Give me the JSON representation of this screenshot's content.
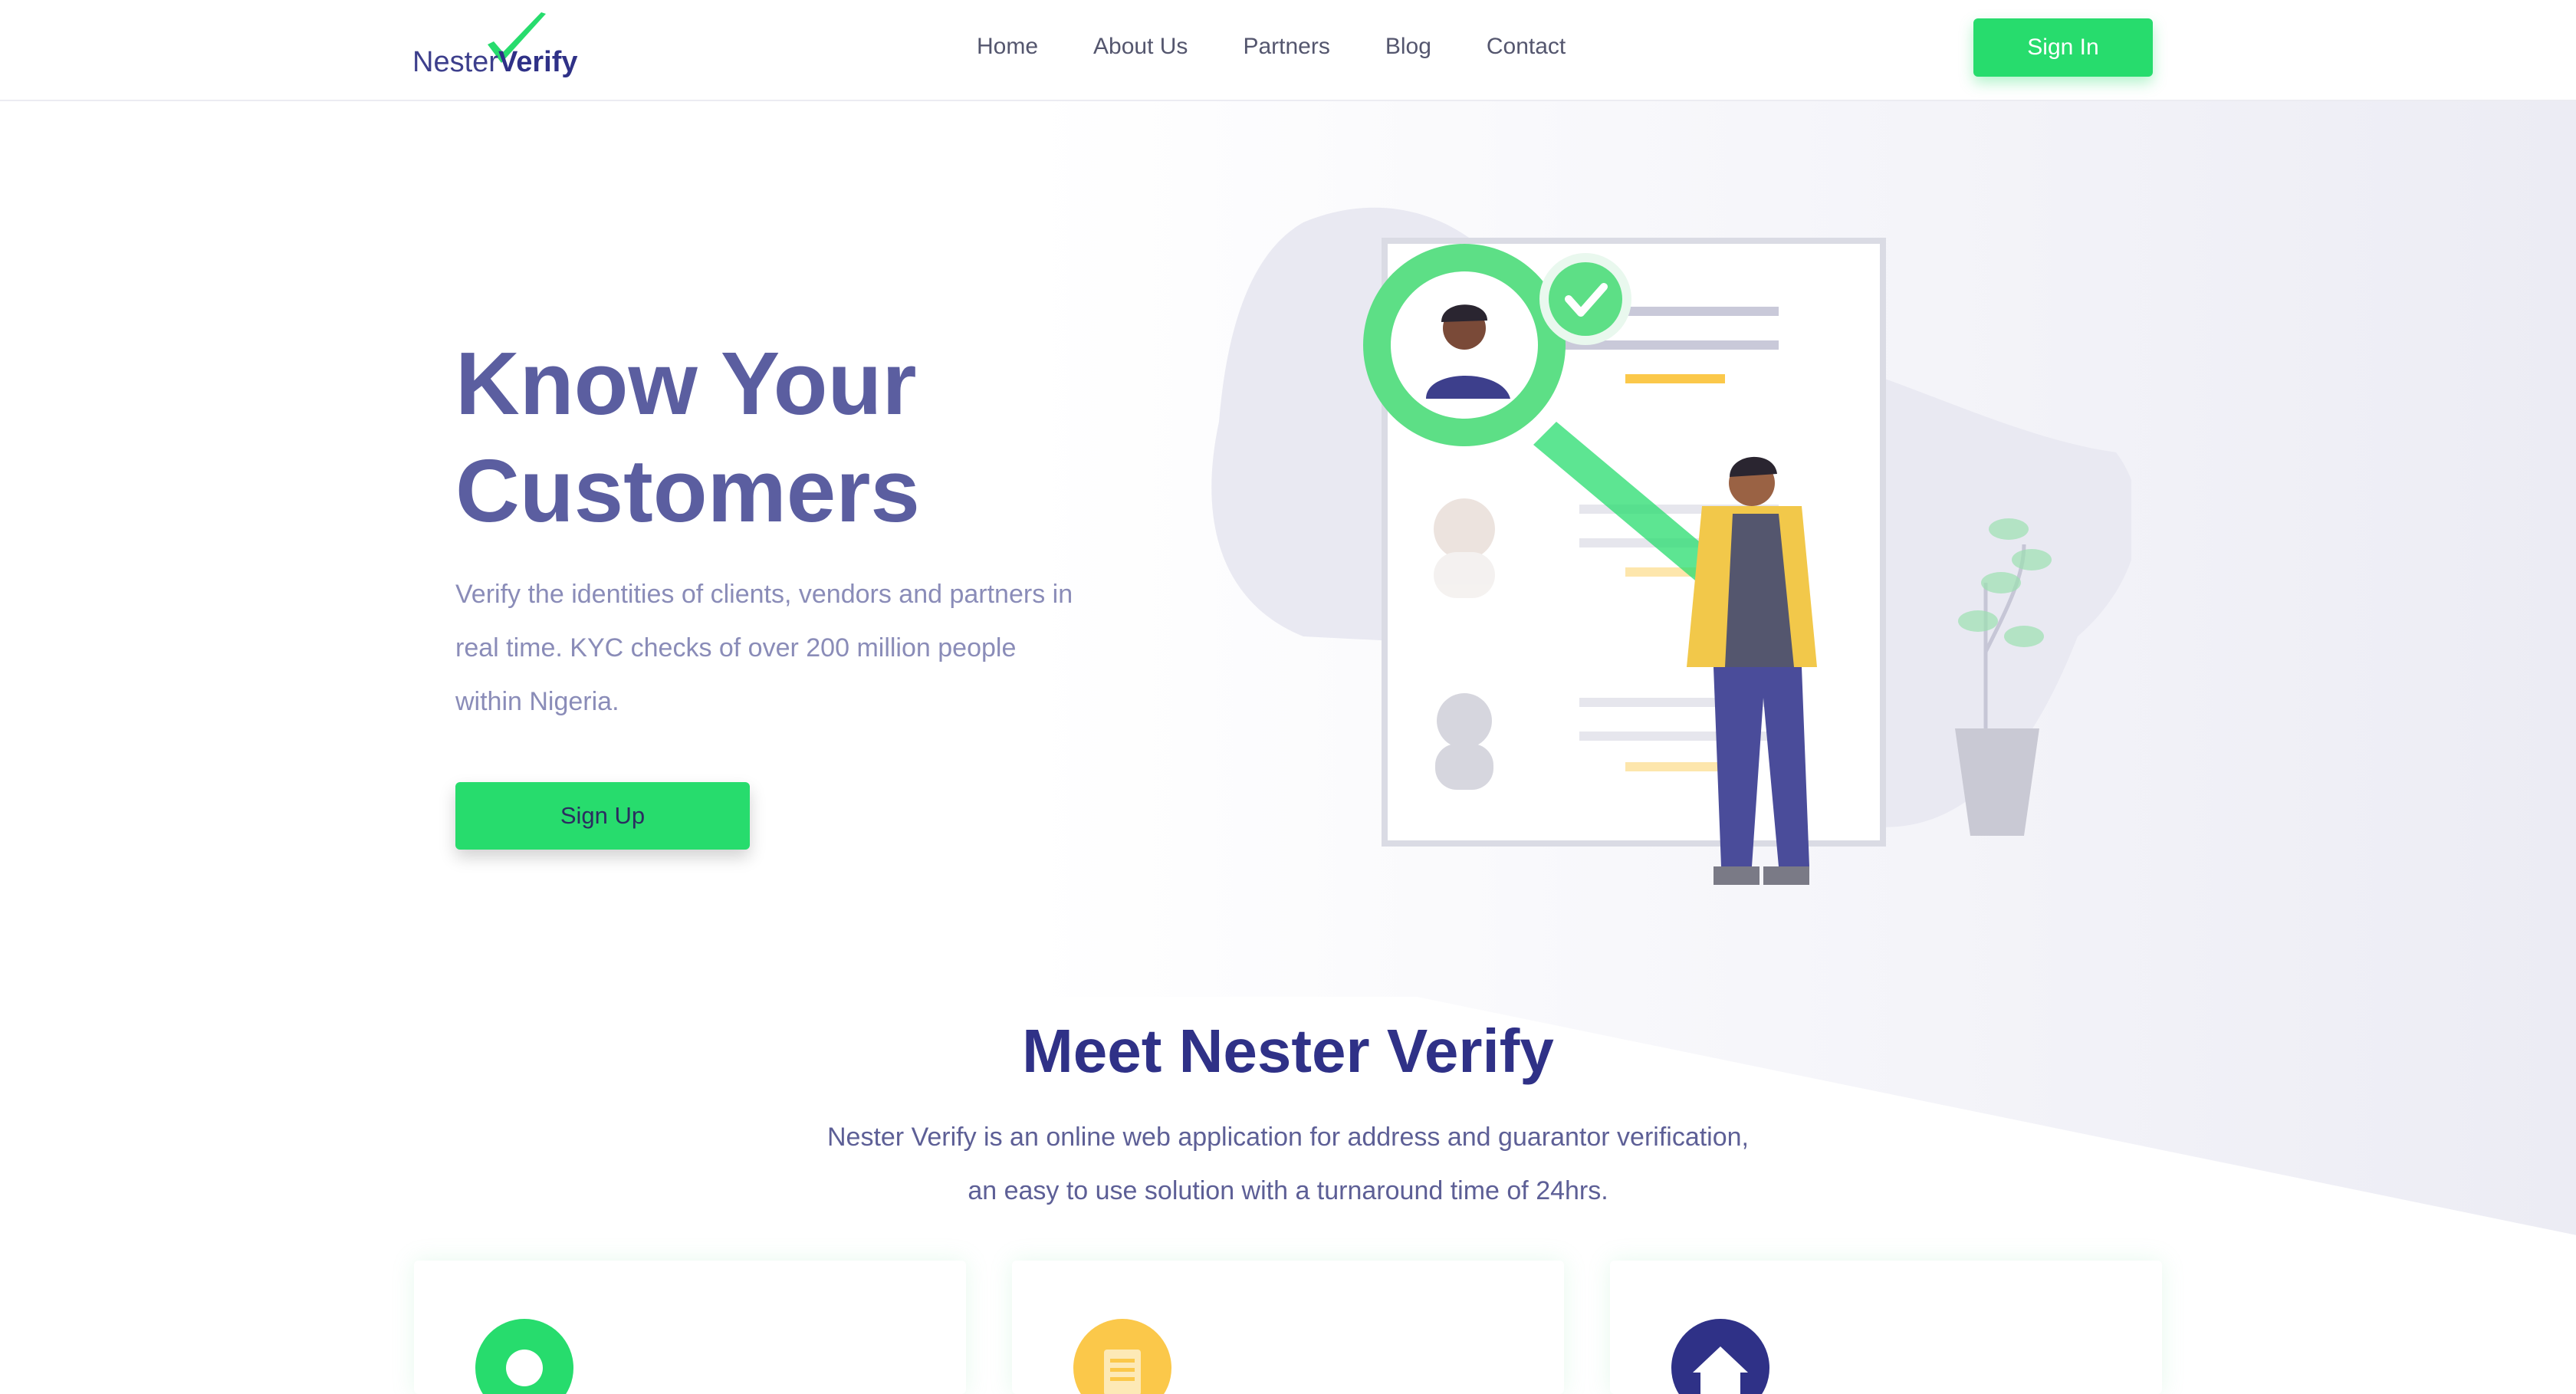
{
  "brand": {
    "name_part1": "Nester",
    "name_part2": "Verify",
    "accent": "#27dc6d",
    "primary": "#2f3187"
  },
  "nav": {
    "links": [
      "Home",
      "About Us",
      "Partners",
      "Blog",
      "Contact"
    ],
    "signin_label": "Sign In"
  },
  "hero": {
    "title_line1": "Know Your",
    "title_line2": "Customers",
    "sub_line1": "Verify the identities of clients, vendors and partners in",
    "sub_line2": "real time. KYC checks of over 200 million people",
    "sub_line3": "within Nigeria.",
    "signup_label": "Sign Up"
  },
  "meet": {
    "title": "Meet Nester Verify",
    "sub_line1": "Nester Verify is an online web application for address and guarantor verification,",
    "sub_line2": "an easy to use solution with a turnaround time of 24hrs."
  },
  "cards": [
    {
      "icon": "person-icon",
      "color": "#27dc6d"
    },
    {
      "icon": "document-icon",
      "color": "#fbc84a"
    },
    {
      "icon": "home-icon",
      "color": "#2f3187"
    }
  ]
}
